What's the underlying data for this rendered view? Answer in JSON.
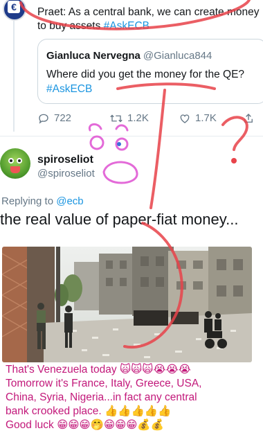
{
  "top_tweet": {
    "text": "Praet: As a central bank, we can create money",
    "text_line2": "to buy assets ",
    "hashtag": "#AskECB"
  },
  "quote": {
    "name": "Gianluca Nervegna",
    "handle": "@Gianluca844",
    "text": "Where did you get the money for the QE?",
    "hashtag": "#AskECB"
  },
  "actions": {
    "replies": "722",
    "retweets": "1.2K",
    "likes": "1.7K"
  },
  "reply_tweet": {
    "name": "spiroseliot",
    "handle": "@spiroseliot",
    "replying_label": "Replying to ",
    "replying_mention": "@ecb",
    "text": "the real value of paper-fiat money..."
  },
  "caption": {
    "line1": "That's Venezuela today 🙀🙀🙀😭😭😭",
    "line2": "Tomorrow it's France, Italy, Greece, USA,",
    "line3": "China, Syria, Nigeria...in fact any central",
    "line4": "bank crooked place. 👍👍👍👍👍",
    "line5": "Good luck 😁😁😁🤭😁😁😁💰💰"
  },
  "colors": {
    "link": "#1b95e0",
    "secondary_text": "#657786",
    "caption_text": "#c2187a",
    "scribble_red": "#e8434a",
    "scribble_pink": "#e36ad8"
  }
}
